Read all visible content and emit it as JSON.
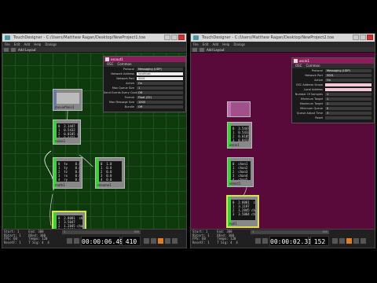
{
  "left": {
    "title": "TouchDesigner - C:/Users/Matthew Ragan/Desktop/NewProject1.toe",
    "menu": [
      "File",
      "Edit",
      "Add",
      "Help",
      "Dialogs"
    ],
    "path_label": "Add Layout",
    "params": {
      "title": "oscout1",
      "tabs": [
        "OSC",
        "Common"
      ],
      "rows": [
        {
          "label": "Protocol",
          "value": "Messaging (UDP)"
        },
        {
          "label": "Network Address",
          "value": "localhost"
        },
        {
          "label": "Network Port",
          "value": "5001"
        },
        {
          "label": "Active",
          "value": "On"
        },
        {
          "label": "Max Queue Size",
          "value": "1"
        },
        {
          "label": "Send Events Every Cook",
          "value": "Off"
        },
        {
          "label": "Format",
          "value": "Float (32)"
        },
        {
          "label": "Max Message Size",
          "value": "1000"
        },
        {
          "label": "Bundle",
          "value": "Off"
        }
      ]
    },
    "nodes": {
      "top": {
        "name": "moviefilein1",
        "values": ""
      },
      "chop1": {
        "name": "noise1",
        "values": "0  2.1447  chan1\n1  0.5432\n2  0.0105 chan2\n3  0.0431 chan3"
      },
      "chop2": {
        "name": "math1",
        "values": "0  tx    0.0\n1  ty    0.0\n2  tz    0.0\n3  rx    0.0\n4  ry    0.0\n5  rz    0.0"
      },
      "chop3": {
        "name": "rename1",
        "values": "0  1.0\n1  0.0\n2  0.0\n3  0.0\n4  0.0\n5  0.0"
      },
      "chop4": {
        "name": "oscout1",
        "values": "0  2.8081  chan1\n1  3.5047\n2  1.2845 chan2\n3  3.5084 chan3"
      }
    },
    "timeline": {
      "stats": "Start: 1     End: 300\nRStart: 1    REnd: 300\nFPS: 60      Tempo: 120\nResetF: 1    T Sig: 4  4",
      "range_start": "1",
      "range_end": "300",
      "timecode": "00:00:06.49",
      "frame": "410"
    }
  },
  "right": {
    "title": "TouchDesigner - C:/Users/Matthew Ragan/Desktop/NewProject2.toe",
    "menu": [
      "File",
      "Edit",
      "Add",
      "Help",
      "Dialogs"
    ],
    "path_label": "Add Layout",
    "params": {
      "title": "oscin1",
      "tabs": [
        "OSC",
        "Common"
      ],
      "rows": [
        {
          "label": "Protocol",
          "value": "Messaging (UDP)"
        },
        {
          "label": "Network Port",
          "value": "5001"
        },
        {
          "label": "Active",
          "value": "On"
        },
        {
          "label": "OSC Address Scope",
          "value": ""
        },
        {
          "label": "Local Address",
          "value": ""
        },
        {
          "label": "Number Of Samples",
          "value": "1"
        },
        {
          "label": "Minimum Target",
          "value": "1"
        },
        {
          "label": "Maximum Target",
          "value": "1"
        },
        {
          "label": "Minimum Queue",
          "value": "0"
        },
        {
          "label": "Queue Adjust Time",
          "value": "3"
        },
        {
          "label": "Reset",
          "value": ""
        }
      ]
    },
    "nodes": {
      "chop1": {
        "name": "oscin1",
        "values": "0  3.5447  chan1\n1  0.5432\n2  0.0105 chan2\n3  0.0431"
      },
      "chop2": {
        "name": "select1",
        "values": "0  chan1  1.0\n1  chan2  0.0\n2  chan3  0.0\n3  chan4  0.0\n4  chan5  0.0"
      },
      "chop3": {
        "name": "null1",
        "values": "0  2.8081  chan1\n1  3.1197\n2  1.2845 chan2\n3  3.5084 chan3"
      }
    },
    "timeline": {
      "stats": "Start: 1     End: 300\nRStart: 1    REnd: 300\nFPS: 60      Tempo: 120\nResetF: 1    T Sig: 4  4",
      "range_start": "1",
      "range_end": "300",
      "timecode": "00:00:02.31",
      "frame": "152"
    }
  },
  "colors": {
    "green_bg": "#0e3a0e",
    "maroon_bg": "#5a0a3a",
    "accent": "#8a1d5a",
    "play": "#e87b1f"
  }
}
